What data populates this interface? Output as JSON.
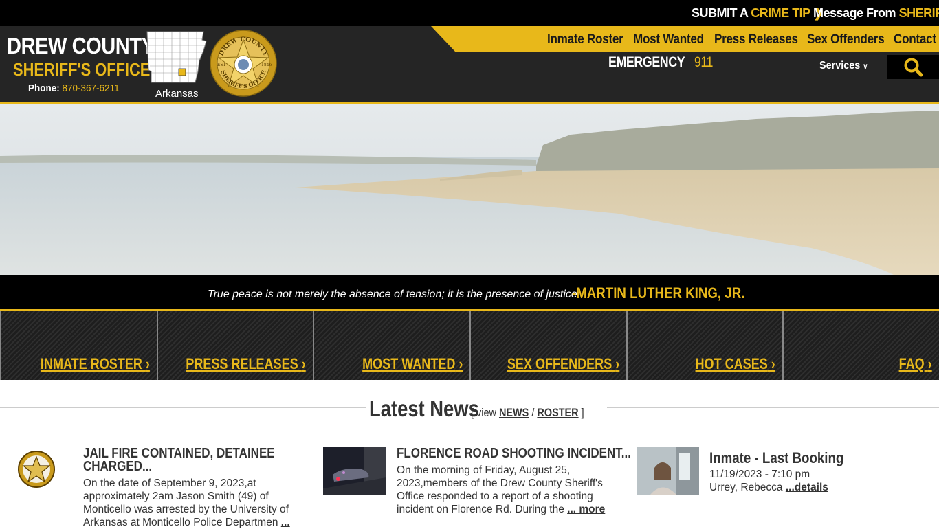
{
  "topbar": {
    "crime_tip_prefix": "SUBMIT A",
    "crime_tip_accent": "CRIME TIP",
    "message_prefix": "Message From",
    "message_accent": "SHERIFF"
  },
  "brand": {
    "line1": "DREW COUNTY",
    "line2": "SHERIFF'S OFFICE",
    "phone_label": "Phone:",
    "phone_number": "870-367-6211",
    "map_label": "Arkansas",
    "badge_text_top": "DREW COUNTY",
    "badge_text_bottom": "SHERIFF'S OFFICE",
    "badge_est": "EST",
    "badge_year": "1846"
  },
  "nav": {
    "items": [
      "Inmate Roster",
      "Most Wanted",
      "Press Releases",
      "Sex Offenders",
      "Contact"
    ],
    "emergency_label": "EMERGENCY",
    "emergency_number": "911",
    "services_label": "Services"
  },
  "quote": {
    "text": "True peace is not merely the absence of tension; it is the presence of justice",
    "author": "-MARTIN LUTHER KING, JR."
  },
  "tiles": [
    "INMATE ROSTER",
    "PRESS RELEASES",
    "MOST WANTED",
    "SEX OFFENDERS",
    "HOT CASES",
    "FAQ"
  ],
  "latest_news": {
    "title": "Latest News",
    "view_open": "[ view",
    "news_link": "NEWS",
    "sep": "/",
    "roster_link": "ROSTER",
    "view_close": "]"
  },
  "news": [
    {
      "title_line1": "JAIL FIRE CONTAINED, DETAINEE",
      "title_line2": "CHARGED...",
      "body_lines": [
        "On the date of September 9, 2023,at",
        "approximately 2am Jason Smith (49) of",
        "Monticello was arrested by the University of"
      ],
      "body_last": "Arkansas at Monticello Police Departmen",
      "more": "..."
    },
    {
      "title_line1": "FLORENCE ROAD SHOOTING INCIDENT...",
      "body_lines": [
        "On the morning of Friday, August 25,",
        "2023,members of the Drew County Sheriff's",
        "Office responded to a report of a shooting"
      ],
      "body_last": "incident on Florence Rd. During the",
      "more": "... more"
    },
    {
      "title_line1": "Inmate - Last Booking",
      "date": "11/19/2023 - 7:10 pm",
      "name": "Urrey, Rebecca",
      "more": "...details"
    }
  ],
  "colors": {
    "gold": "#e8b81a",
    "dark": "#252525",
    "black": "#000000"
  }
}
